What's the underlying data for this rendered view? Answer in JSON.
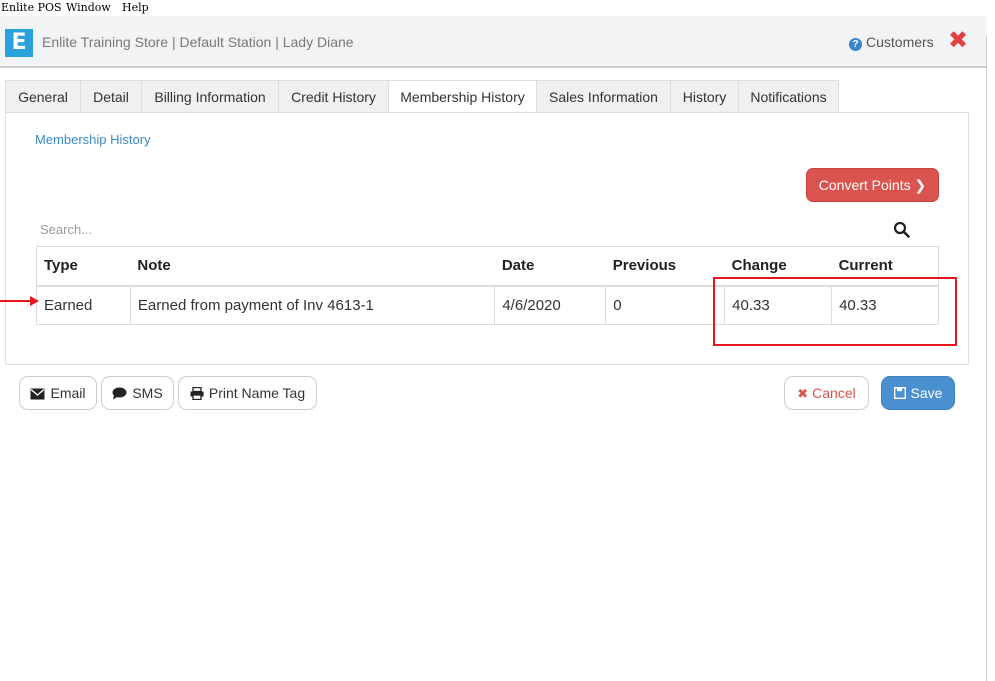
{
  "menubar": {
    "app": "Enlite POS",
    "window": "Window",
    "help": "Help"
  },
  "header": {
    "logo_letter": "E",
    "title": "Enlite Training Store | Default Station | Lady Diane",
    "customers_label": "Customers",
    "close_glyph": "✖"
  },
  "tabs": [
    {
      "label": "General"
    },
    {
      "label": "Detail"
    },
    {
      "label": "Billing Information"
    },
    {
      "label": "Credit History"
    },
    {
      "label": "Membership History",
      "active": true
    },
    {
      "label": "Sales Information"
    },
    {
      "label": "History"
    },
    {
      "label": "Notifications"
    }
  ],
  "section": {
    "title": "Membership History"
  },
  "convert_button": {
    "label": "Convert Points",
    "glyph": "❯"
  },
  "search": {
    "placeholder": "Search..."
  },
  "table": {
    "headers": [
      "Type",
      "Note",
      "Date",
      "Previous",
      "Change",
      "Current"
    ],
    "rows": [
      [
        "Earned",
        "Earned from payment of Inv 4613-1",
        "4/6/2020",
        "0",
        "40.33",
        "40.33"
      ]
    ]
  },
  "buttons": {
    "email": "Email",
    "sms": "SMS",
    "print_name_tag": "Print Name Tag",
    "cancel": "Cancel",
    "save": "Save"
  },
  "colors": {
    "accent": "#2aa0dc",
    "danger": "#d9534f",
    "primary": "#4a90d0",
    "annotation": "#e8141c"
  }
}
